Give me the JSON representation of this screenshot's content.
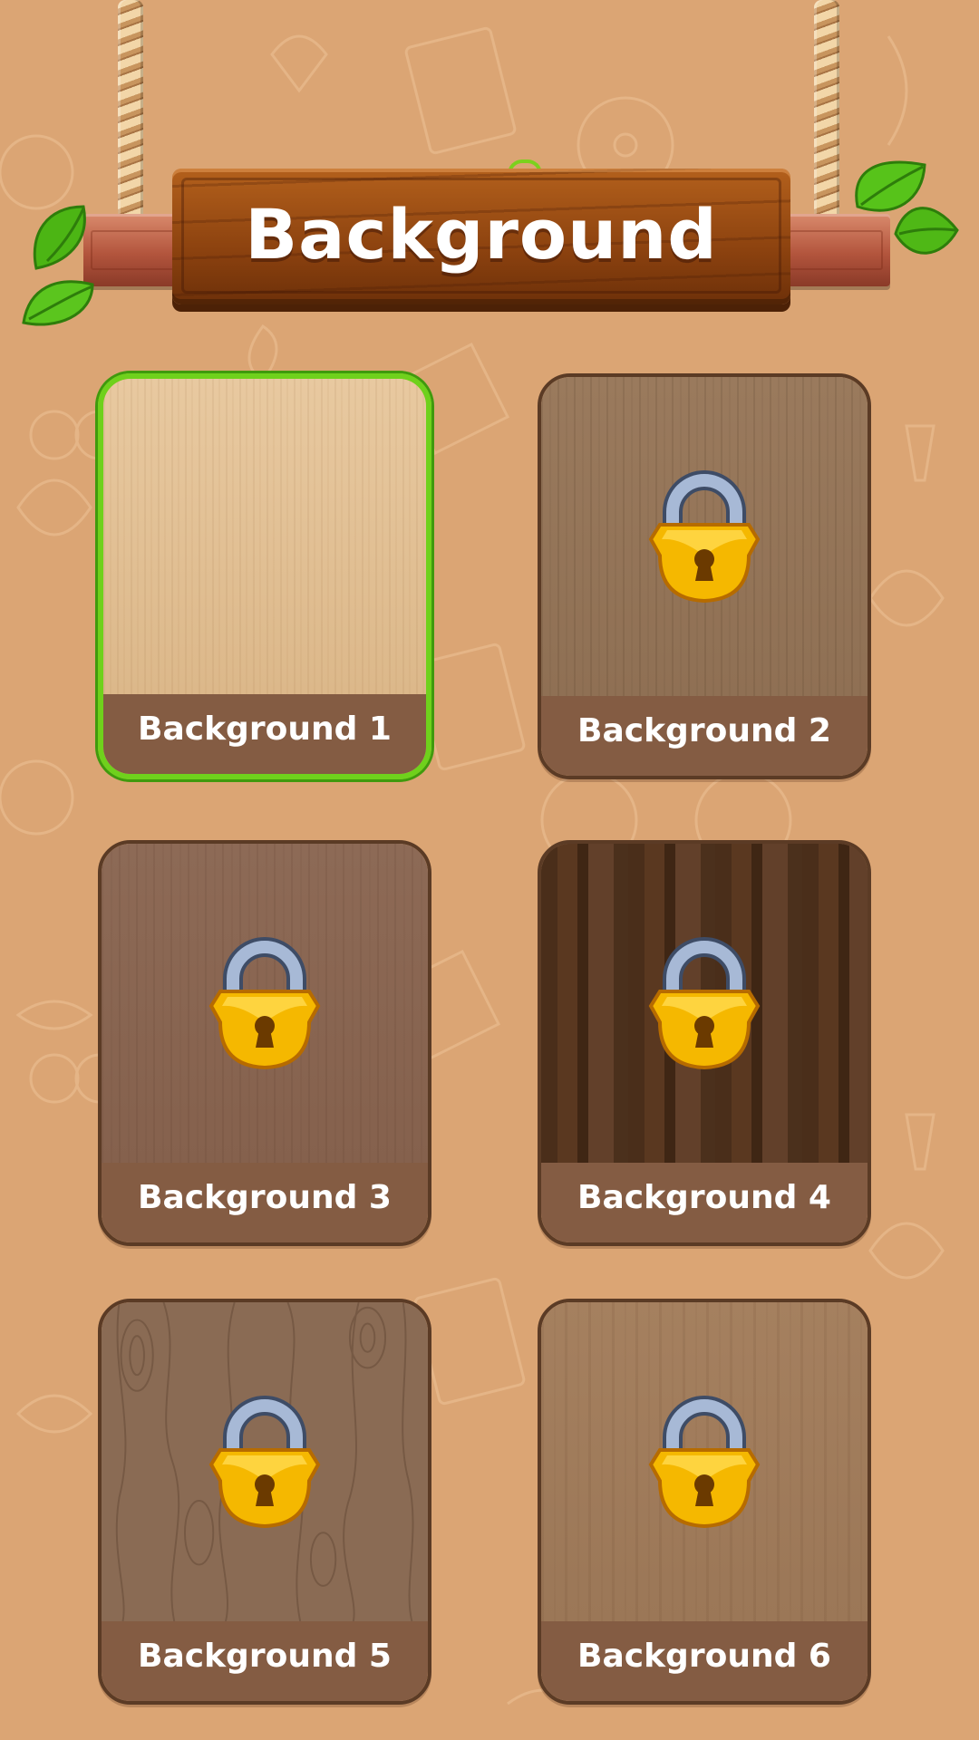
{
  "header": {
    "title": "Background"
  },
  "backgrounds": [
    {
      "label": "Background 1",
      "locked": false,
      "selected": true
    },
    {
      "label": "Background 2",
      "locked": true,
      "selected": false
    },
    {
      "label": "Background 3",
      "locked": true,
      "selected": false
    },
    {
      "label": "Background 4",
      "locked": true,
      "selected": false
    },
    {
      "label": "Background 5",
      "locked": true,
      "selected": false
    },
    {
      "label": "Background 6",
      "locked": true,
      "selected": false
    }
  ],
  "colors": {
    "page_background": "#dba574",
    "sign_wood": "#8c420f",
    "card_label_bar": "#845c43",
    "selected_border": "#6fd11c",
    "lock_gold": "#f5b800",
    "lock_shackle": "#8ea4c8"
  },
  "icons": {
    "lock": "padlock-icon",
    "leaf": "leaf-icon"
  }
}
